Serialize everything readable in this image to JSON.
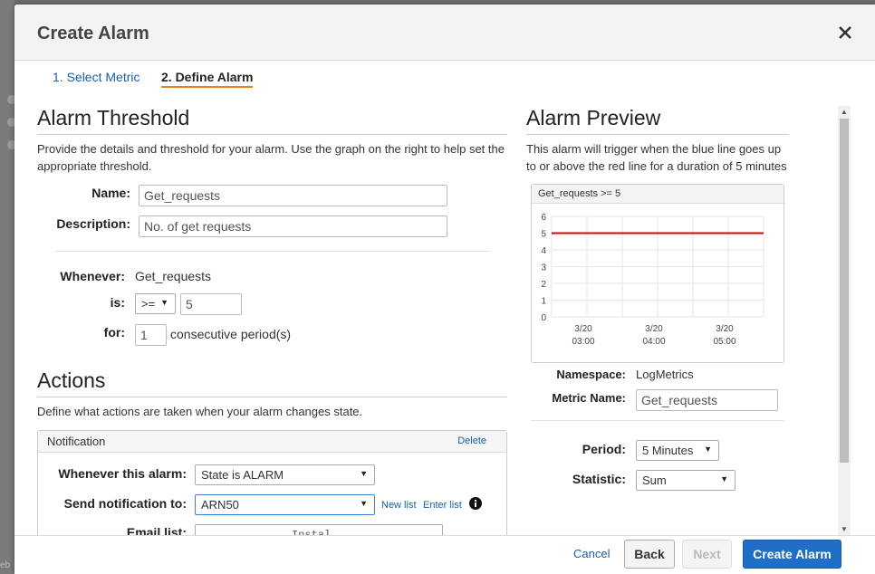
{
  "dialog": {
    "title": "Create Alarm",
    "steps": [
      {
        "label": "1. Select Metric"
      },
      {
        "label": "2. Define Alarm"
      }
    ]
  },
  "threshold": {
    "heading": "Alarm Threshold",
    "description": "Provide the details and threshold for your alarm. Use the graph on the right to help set the appropriate threshold.",
    "name_label": "Name:",
    "name_value": "Get_requests",
    "description_label": "Description:",
    "description_value": "No. of get requests",
    "whenever_label": "Whenever:",
    "whenever_value": "Get_requests",
    "is_label": "is:",
    "operator": ">=",
    "threshold_value": "5",
    "for_label": "for:",
    "periods_value": "1",
    "periods_suffix": "consecutive period(s)"
  },
  "actions": {
    "heading": "Actions",
    "description": "Define what actions are taken when your alarm changes state.",
    "notification_title": "Notification",
    "delete_label": "Delete",
    "whenever_alarm_label": "Whenever this alarm:",
    "state_value": "State is ALARM",
    "send_to_label": "Send notification to:",
    "send_to_value": "ARN50",
    "new_list_label": "New list",
    "enter_list_label": "Enter list",
    "email_list_label": "Email list:",
    "email_list_value": "Instal"
  },
  "preview": {
    "heading": "Alarm Preview",
    "description": "This alarm will trigger when the blue line goes up to or above the red line for a duration of 5 minutes",
    "chart_title": "Get_requests >= 5",
    "namespace_label": "Namespace:",
    "namespace_value": "LogMetrics",
    "metric_name_label": "Metric Name:",
    "metric_name_value": "Get_requests",
    "period_label": "Period:",
    "period_value": "5 Minutes",
    "statistic_label": "Statistic:",
    "statistic_value": "Sum"
  },
  "chart_data": {
    "type": "line",
    "title": "Get_requests >= 5",
    "y_ticks": [
      "6",
      "5",
      "4",
      "3",
      "2",
      "1",
      "0"
    ],
    "ylim": [
      0,
      6
    ],
    "x_ticks": [
      {
        "date": "3/20",
        "time": "03:00"
      },
      {
        "date": "3/20",
        "time": "04:00"
      },
      {
        "date": "3/20",
        "time": "05:00"
      }
    ],
    "threshold": 5,
    "threshold_color": "#e00000",
    "grid": true
  },
  "footer": {
    "cancel_label": "Cancel",
    "back_label": "Back",
    "next_label": "Next",
    "create_label": "Create Alarm"
  },
  "background_text": "eb"
}
